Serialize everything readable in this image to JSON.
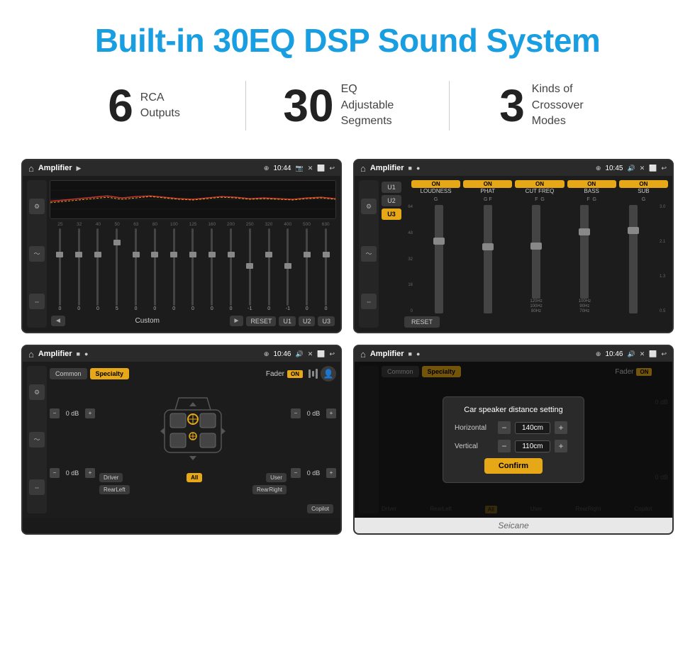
{
  "header": {
    "title": "Built-in 30EQ DSP Sound System"
  },
  "features": [
    {
      "number": "6",
      "text_line1": "RCA",
      "text_line2": "Outputs"
    },
    {
      "number": "30",
      "text_line1": "EQ Adjustable",
      "text_line2": "Segments"
    },
    {
      "number": "3",
      "text_line1": "Kinds of",
      "text_line2": "Crossover Modes"
    }
  ],
  "screens": {
    "eq_screen": {
      "app_name": "Amplifier",
      "time": "10:44",
      "freq_labels": [
        "25",
        "32",
        "40",
        "50",
        "63",
        "80",
        "100",
        "125",
        "160",
        "200",
        "250",
        "320",
        "400",
        "500",
        "630"
      ],
      "slider_values": [
        "0",
        "0",
        "0",
        "5",
        "0",
        "0",
        "0",
        "0",
        "0",
        "0",
        "-1",
        "0",
        "-1"
      ],
      "bottom_labels": [
        "Custom",
        "RESET",
        "U1",
        "U2",
        "U3"
      ]
    },
    "channel_screen": {
      "app_name": "Amplifier",
      "time": "10:45",
      "channels": [
        "LOUDNESS",
        "PHAT",
        "CUT FREQ",
        "BASS",
        "SUB"
      ],
      "u_buttons": [
        "U1",
        "U2",
        "U3"
      ],
      "active_u": "U3",
      "reset_label": "RESET"
    },
    "specialty_screen": {
      "app_name": "Amplifier",
      "time": "10:46",
      "tabs": [
        "Common",
        "Specialty"
      ],
      "active_tab": "Specialty",
      "fader_label": "Fader",
      "on_label": "ON",
      "controls": [
        {
          "label": "0 dB"
        },
        {
          "label": "0 dB"
        },
        {
          "label": "0 dB"
        },
        {
          "label": "0 dB"
        }
      ],
      "bottom_labels": [
        "Driver",
        "RearLeft",
        "All",
        "User",
        "RearRight",
        "Copilot"
      ]
    },
    "dialog_screen": {
      "app_name": "Amplifier",
      "time": "10:46",
      "dialog_title": "Car speaker distance setting",
      "horizontal_label": "Horizontal",
      "horizontal_value": "140cm",
      "vertical_label": "Vertical",
      "vertical_value": "110cm",
      "confirm_label": "Confirm",
      "bottom_labels": [
        "Driver",
        "RearLeft",
        "All",
        "User",
        "RearRight",
        "Copilot"
      ],
      "right_labels": [
        "0 dB",
        "0 dB"
      ]
    }
  },
  "watermark": "Seicane"
}
